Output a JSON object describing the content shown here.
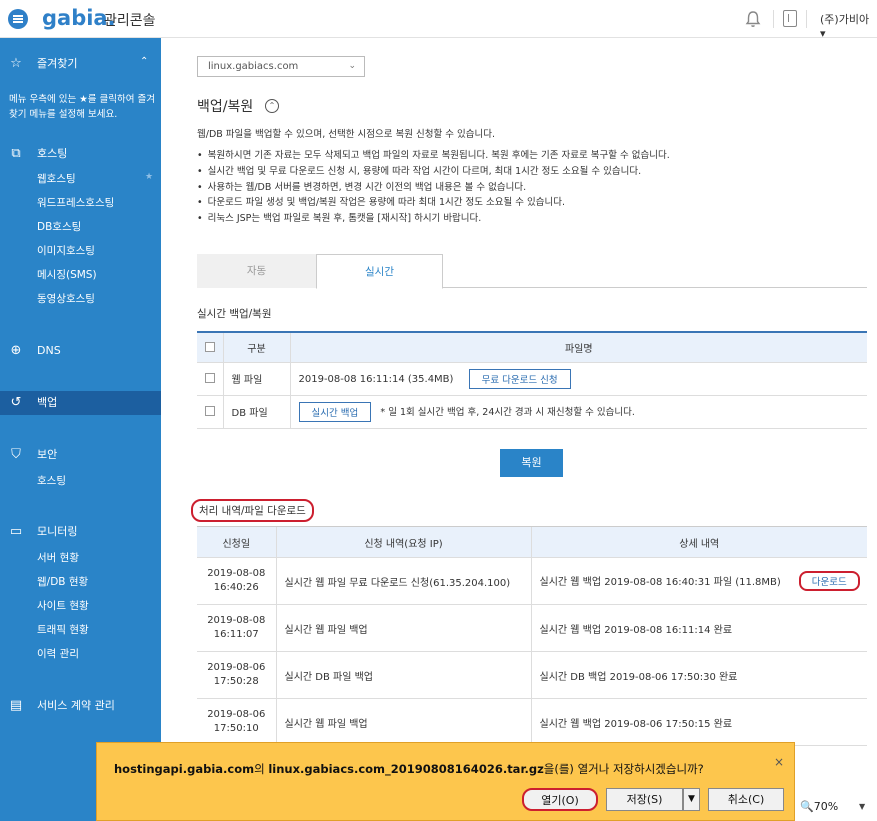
{
  "topbar": {
    "logo": "gabia.",
    "console_title": "관리콘솔",
    "user_name": "(주)가비아",
    "user_chevron": "▾"
  },
  "sidebar": {
    "favorites": {
      "label": "즐겨찾기",
      "chevron": "⌃",
      "note": "메뉴 우측에 있는 ★를 클릭하여 즐겨찾기 메뉴를 설정해 보세요."
    },
    "hosting": {
      "label": "호스팅",
      "items": [
        "웹호스팅",
        "워드프레스호스팅",
        "DB호스팅",
        "이미지호스팅",
        "메시징(SMS)",
        "동영상호스팅"
      ]
    },
    "dns": {
      "label": "DNS"
    },
    "backup": {
      "label": "백업"
    },
    "security": {
      "label": "보안",
      "items": [
        "호스팅"
      ]
    },
    "monitoring": {
      "label": "모니터링",
      "items": [
        "서버 현황",
        "웹/DB 현황",
        "사이트 현황",
        "트래픽 현황",
        "이력 관리"
      ]
    },
    "contract": {
      "label": "서비스 계약 관리"
    }
  },
  "main": {
    "domain": "linux.gabiacs.com",
    "title": "백업/복원",
    "description": "웹/DB 파일을 백업할 수 있으며, 선택한 시점으로 복원 신청할 수 있습니다.",
    "bullets": [
      "복원하시면 기존 자료는 모두 삭제되고 백업 파일의 자료로 복원됩니다. 복원 후에는 기존 자료로 복구할 수 없습니다.",
      "실시간 백업 및 무료 다운로드 신청 시, 용량에 따라 작업 시간이 다르며, 최대 1시간 정도 소요될 수 있습니다.",
      "사용하는 웹/DB 서버를 변경하면, 변경 시간 이전의 백업 내용은 볼 수 없습니다.",
      "다운로드 파일 생성 및 백업/복원 작업은 용량에 따라 최대 1시간 정도 소요될 수 있습니다.",
      "리눅스 JSP는 백업 파일로 복원 후, 톰캣을 [재시작] 하시기 바랍니다."
    ],
    "tabs": {
      "auto": "자동",
      "realtime": "실시간"
    },
    "realtime_title": "실시간 백업/복원",
    "backup_table": {
      "headers": [
        "구분",
        "파일명"
      ],
      "rows": [
        {
          "type": "웹 파일",
          "file": "2019-08-08 16:11:14 (35.4MB)",
          "button": "무료 다운로드 신청"
        },
        {
          "type": "DB 파일",
          "button": "실시간 백업",
          "note": "* 일 1회 실시간 백업 후, 24시간 경과 시 재신청할 수 있습니다."
        }
      ]
    },
    "restore_button": "복원",
    "history_title": "처리 내역/파일 다운로드",
    "history_table": {
      "headers": [
        "신청일",
        "신청 내역(요청 IP)",
        "상세 내역"
      ],
      "rows": [
        {
          "date": "2019-08-08",
          "time": "16:40:26",
          "request": "실시간 웹 파일 무료 다운로드 신청(61.35.204.100)",
          "detail": "실시간 웹 백업 2019-08-08 16:40:31 파일 (11.8MB)",
          "action": "다운로드"
        },
        {
          "date": "2019-08-08",
          "time": "16:11:07",
          "request": "실시간 웹 파일 백업",
          "detail": "실시간 웹 백업 2019-08-08 16:11:14 완료"
        },
        {
          "date": "2019-08-06",
          "time": "17:50:28",
          "request": "실시간 DB 파일 백업",
          "detail": "실시간 DB 백업 2019-08-06 17:50:30 완료"
        },
        {
          "date": "2019-08-06",
          "time": "17:50:10",
          "request": "실시간 웹 파일 백업",
          "detail": "실시간 웹 백업 2019-08-06 17:50:15 완료"
        }
      ]
    }
  },
  "download_bar": {
    "host": "hostingapi.gabia.com",
    "host_suffix": "의 ",
    "filename": "linux.gabiacs.com_20190808164026.tar.gz",
    "message_suffix": "을(를) 열거나 저장하시겠습니까?",
    "open": "열기(O)",
    "save": "저장(S)",
    "cancel": "취소(C)",
    "close": "×"
  },
  "status": {
    "zoom": "70%"
  },
  "colors": {
    "brand_blue": "#2a84c8",
    "sidebar_active": "#1c5fa0",
    "highlight_red": "#cc1f2f",
    "download_bar": "#fdc64d"
  }
}
